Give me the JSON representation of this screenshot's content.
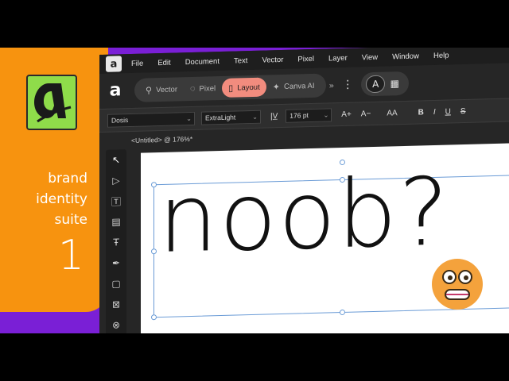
{
  "brand": {
    "lines": [
      "brand",
      "identity",
      "suite"
    ],
    "number": "1",
    "colors": {
      "orange": "#f7930f",
      "purple": "#7a1fd6",
      "logo_green": "#8fdc4a"
    }
  },
  "menubar": {
    "items": [
      "File",
      "Edit",
      "Document",
      "Text",
      "Vector",
      "Pixel",
      "Layer",
      "View",
      "Window",
      "Help"
    ]
  },
  "toolbar": {
    "personas": [
      {
        "label": "Vector",
        "icon": "pen-nib-icon"
      },
      {
        "label": "Pixel",
        "icon": "brush-icon"
      },
      {
        "label": "Layout",
        "icon": "layout-icon",
        "active": true
      },
      {
        "label": "Canva AI",
        "icon": "sparkle-icon"
      }
    ],
    "more": "»",
    "accent": "#f28c7e"
  },
  "context": {
    "font_family": "Dosis",
    "font_style": "ExtraLight",
    "font_size": "176 pt",
    "tracking_icon": "|V̲",
    "increase_size": "A+",
    "decrease_size": "A−",
    "all_caps": "AA",
    "bold": "B",
    "italic": "I",
    "underline": "U",
    "strike": "S"
  },
  "document": {
    "tab_title": "<Untitled> @ 176%*",
    "canvas_text": "noob?"
  }
}
